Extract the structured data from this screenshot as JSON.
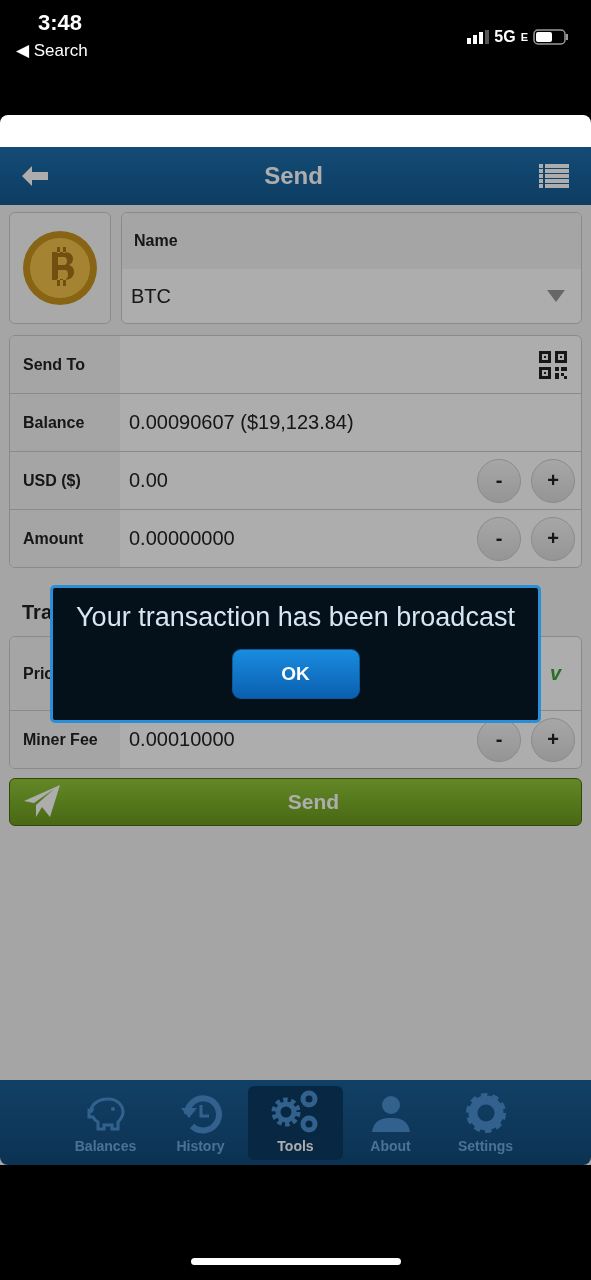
{
  "status_bar": {
    "time": "3:48",
    "back_label": "◀ Search",
    "network": "5G",
    "network_suffix": "E"
  },
  "header": {
    "title": "Send"
  },
  "coin": {
    "name_label": "Name",
    "value": "BTC"
  },
  "fields": [
    {
      "kind": "qr",
      "label": "Send To"
    },
    {
      "kind": "text",
      "label": "Balance",
      "value": "0.00090607 ($19,123.84)"
    },
    {
      "kind": "stepper",
      "label": "USD ($)",
      "value": "0.00",
      "minus": "-",
      "plus": "+"
    },
    {
      "kind": "stepper",
      "label": "Amount",
      "value": "0.00000000",
      "minus": "-",
      "plus": "+"
    }
  ],
  "section_title": "Tra",
  "fee_rows": [
    {
      "kind": "priority",
      "label": "Pric",
      "tail": "v"
    },
    {
      "kind": "stepper",
      "label": "Miner Fee",
      "value": "0.00010000",
      "minus": "-",
      "plus": "+"
    }
  ],
  "send_button": "Send",
  "dialog": {
    "message": "Your transaction has been broadcast",
    "button": "OK"
  },
  "tabs": [
    {
      "label": "Balances",
      "kind": "piggy",
      "selected": false
    },
    {
      "label": "History",
      "kind": "history",
      "selected": false
    },
    {
      "label": "Tools",
      "kind": "gears",
      "selected": true
    },
    {
      "label": "About",
      "kind": "person",
      "selected": false
    },
    {
      "label": "Settings",
      "kind": "gear",
      "selected": false
    }
  ]
}
